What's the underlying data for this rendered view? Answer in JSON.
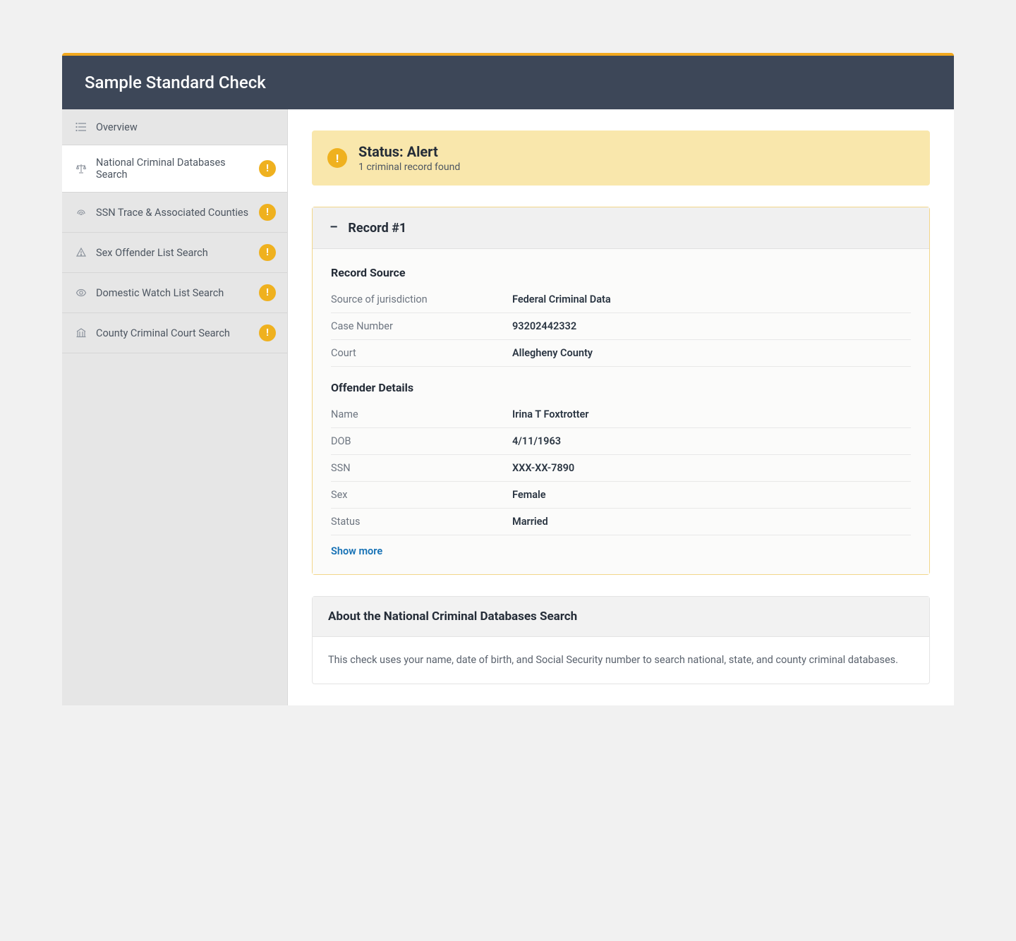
{
  "header": {
    "title": "Sample Standard Check"
  },
  "sidebar": {
    "items": [
      {
        "label": "Overview",
        "alert": false,
        "active": false
      },
      {
        "label": "National Criminal Databases Search",
        "alert": true,
        "active": true
      },
      {
        "label": "SSN Trace & Associated Counties",
        "alert": true,
        "active": false
      },
      {
        "label": "Sex Offender List Search",
        "alert": true,
        "active": false
      },
      {
        "label": "Domestic Watch List Search",
        "alert": true,
        "active": false
      },
      {
        "label": "County Criminal Court Search",
        "alert": true,
        "active": false
      }
    ]
  },
  "status": {
    "title": "Status: Alert",
    "subtitle": "1 criminal record found"
  },
  "record": {
    "title": "Record #1",
    "source": {
      "heading": "Record Source",
      "rows": [
        {
          "k": "Source of jurisdiction",
          "v": "Federal Criminal Data"
        },
        {
          "k": "Case Number",
          "v": "93202442332"
        },
        {
          "k": "Court",
          "v": "Allegheny County"
        }
      ]
    },
    "offender": {
      "heading": "Offender Details",
      "rows": [
        {
          "k": "Name",
          "v": "Irina T Foxtrotter"
        },
        {
          "k": "DOB",
          "v": "4/11/1963"
        },
        {
          "k": "SSN",
          "v": "XXX-XX-7890"
        },
        {
          "k": "Sex",
          "v": "Female"
        },
        {
          "k": "Status",
          "v": "Married"
        }
      ]
    },
    "show_more": "Show more"
  },
  "about": {
    "title": "About the National Criminal Databases Search",
    "body": "This check uses your name, date of birth, and Social Security number to search national, state, and county criminal databases."
  }
}
